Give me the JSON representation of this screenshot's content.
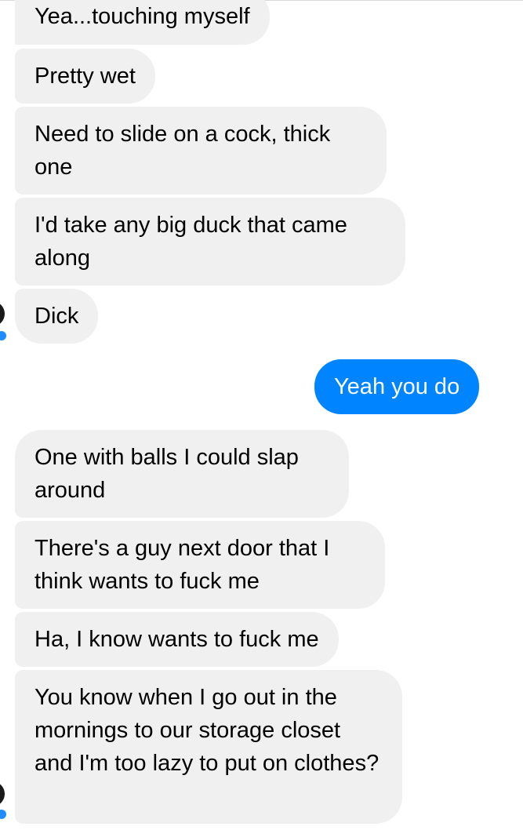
{
  "messages": [
    {
      "direction": "incoming",
      "text": "Yea...touching myself"
    },
    {
      "direction": "incoming",
      "text": "Pretty wet"
    },
    {
      "direction": "incoming",
      "text": "Need to slide on a cock, thick one"
    },
    {
      "direction": "incoming",
      "text": "I'd take any big duck that came along"
    },
    {
      "direction": "incoming",
      "text": "Dick"
    },
    {
      "direction": "outgoing",
      "text": "Yeah you do"
    },
    {
      "direction": "incoming",
      "text": "One with balls I could slap around"
    },
    {
      "direction": "incoming",
      "text": "There's a guy next door that I think wants to fuck me"
    },
    {
      "direction": "incoming",
      "text": "Ha, I know wants to fuck me"
    },
    {
      "direction": "incoming",
      "text": "You know when I go out in the mornings to our storage closet and I'm too lazy to put on clothes?"
    }
  ],
  "colors": {
    "incoming_bubble": "#f0f0f0",
    "outgoing_bubble": "#0084ff",
    "incoming_text": "#000000",
    "outgoing_text": "#ffffff",
    "presence_badge": "#1f8cff"
  }
}
